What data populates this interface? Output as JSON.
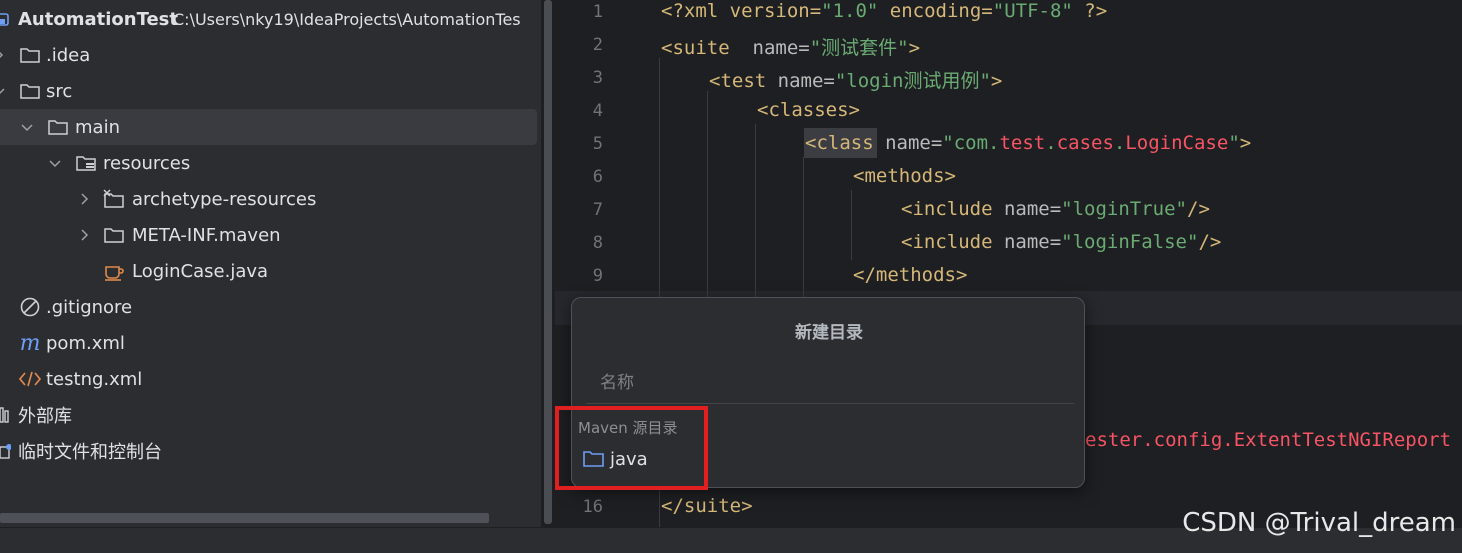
{
  "project_tree": {
    "root": {
      "name": "AutomationTest",
      "path": "C:\\Users\\nky19\\IdeaProjects\\AutomationTes"
    },
    "items": [
      {
        "label": ".idea",
        "icon": "folder-icon"
      },
      {
        "label": "src",
        "icon": "folder-icon"
      },
      {
        "label": "main",
        "icon": "folder-icon"
      },
      {
        "label": "resources",
        "icon": "resources-folder-icon"
      },
      {
        "label": "archetype-resources",
        "icon": "excluded-folder-icon"
      },
      {
        "label": "META-INF.maven",
        "icon": "folder-icon"
      },
      {
        "label": "LoginCase.java",
        "icon": "java-file-icon"
      },
      {
        "label": ".gitignore",
        "icon": "ignore-file-icon"
      },
      {
        "label": "pom.xml",
        "icon": "maven-icon"
      },
      {
        "label": "testng.xml",
        "icon": "xml-file-icon"
      },
      {
        "label": "外部库",
        "icon": "library-icon"
      },
      {
        "label": "临时文件和控制台",
        "icon": "scratches-icon"
      }
    ]
  },
  "editor": {
    "line_numbers": [
      "1",
      "2",
      "3",
      "4",
      "5",
      "6",
      "7",
      "8",
      "9",
      "16"
    ],
    "lines": {
      "l1": {
        "a": "<?xml version=",
        "b": "\"1.0\"",
        "c": " encoding=",
        "d": "\"UTF-8\"",
        "e": " ?>"
      },
      "l2": {
        "a": "<suite",
        "b": "  name=",
        "c": "\"测试套件\"",
        "d": ">"
      },
      "l3": {
        "a": "<test",
        "b": " name=",
        "c": "\"login测试用例\"",
        "d": ">"
      },
      "l4": {
        "a": "<classes>"
      },
      "l5": {
        "a": "<class",
        "b": " name=",
        "c": "\"com.",
        "d": "test",
        "e": ".",
        "f": "cases",
        "g": ".",
        "h": "LoginCase",
        "i": "\"",
        "j": ">"
      },
      "l6": {
        "a": "<methods>"
      },
      "l7": {
        "a": "<include",
        "b": " name=",
        "c": "\"loginTrue\"",
        "d": "/>"
      },
      "l8": {
        "a": "<include",
        "b": " name=",
        "c": "\"loginFalse\"",
        "d": "/>"
      },
      "l9": {
        "a": "</methods>"
      },
      "l_partial": {
        "a": "ester.config.ExtentTestNGIReport"
      },
      "l16": {
        "a": "</suite>"
      }
    }
  },
  "popup": {
    "title": "新建目录",
    "input_placeholder": "名称",
    "input_value": "",
    "group_label": "Maven 源目录",
    "suggestion": "java"
  },
  "watermark": "CSDN @Trival_dream"
}
